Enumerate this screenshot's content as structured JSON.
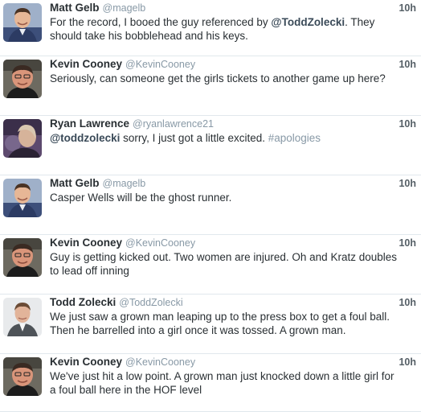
{
  "tweets": [
    {
      "name": "Matt Gelb",
      "handle": "@magelb",
      "time": "10h",
      "text_parts": [
        {
          "t": "For the record, I booed the guy referenced by "
        },
        {
          "t": "@ToddZolecki",
          "k": "mention"
        },
        {
          "t": ". They should take his bobblehead and his keys."
        }
      ],
      "avatar": "matt-gelb-avatar"
    },
    {
      "name": "Kevin Cooney",
      "handle": "@KevinCooney",
      "time": "10h",
      "text_parts": [
        {
          "t": "Seriously, can someone get the girls tickets to another game up here?"
        }
      ],
      "avatar": "kevin-cooney-avatar"
    },
    {
      "name": "Ryan Lawrence",
      "handle": "@ryanlawrence21",
      "time": "10h",
      "text_parts": [
        {
          "t": "@toddzolecki",
          "k": "mention"
        },
        {
          "t": " sorry, I just got a little excited. "
        },
        {
          "t": "#apologies",
          "k": "hashtag"
        }
      ],
      "avatar": "ryan-lawrence-avatar"
    },
    {
      "name": "Matt Gelb",
      "handle": "@magelb",
      "time": "10h",
      "text_parts": [
        {
          "t": "Casper Wells will be the ghost runner."
        }
      ],
      "avatar": "matt-gelb-avatar"
    },
    {
      "name": "Kevin Cooney",
      "handle": "@KevinCooney",
      "time": "10h",
      "text_parts": [
        {
          "t": "Guy is getting kicked out. Two women are injured. Oh and Kratz doubles to lead off inning"
        }
      ],
      "avatar": "kevin-cooney-avatar"
    },
    {
      "name": "Todd Zolecki",
      "handle": "@ToddZolecki",
      "time": "10h",
      "text_parts": [
        {
          "t": "We just saw a grown man leaping up to the press box to get a foul ball. Then he barrelled into a girl once it was tossed. A grown man."
        }
      ],
      "avatar": "todd-zolecki-avatar"
    },
    {
      "name": "Kevin Cooney",
      "handle": "@KevinCooney",
      "time": "10h",
      "text_parts": [
        {
          "t": "We've just hit a low point. A grown man just knocked down a little girl for a foul ball here in the HOF level"
        }
      ],
      "avatar": "kevin-cooney-avatar"
    }
  ]
}
